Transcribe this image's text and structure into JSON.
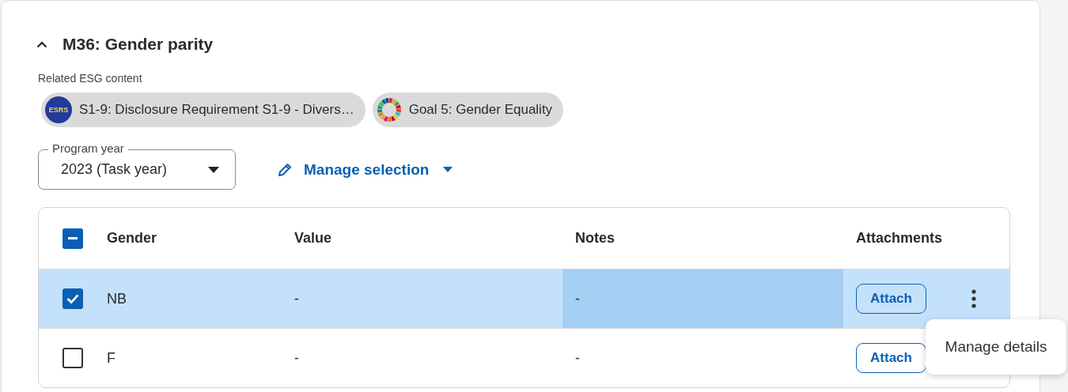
{
  "section": {
    "title": "M36: Gender parity",
    "expanded": true
  },
  "related": {
    "label": "Related ESG content",
    "chips": [
      {
        "kind": "esrs",
        "badge": "ESRS",
        "label": "S1-9: Disclosure Requirement S1-9 - Divers…"
      },
      {
        "kind": "sdg",
        "label": "Goal 5: Gender Equality"
      }
    ]
  },
  "program_year": {
    "label": "Program year",
    "value": "2023 (Task year)"
  },
  "manage_selection": {
    "label": "Manage selection"
  },
  "table": {
    "select_all": {
      "checked": true,
      "indeterminate": true
    },
    "columns": [
      "Gender",
      "Value",
      "Notes",
      "Attachments"
    ],
    "rows": [
      {
        "gender": "NB",
        "value": "-",
        "notes": "-",
        "attach": "Attach",
        "checked": true,
        "selected": true,
        "notes_hovered": true,
        "menu_open": true
      },
      {
        "gender": "F",
        "value": "-",
        "notes": "-",
        "attach": "Attach",
        "checked": false,
        "selected": false,
        "notes_hovered": false,
        "menu_open": false
      }
    ]
  },
  "row_menu": {
    "items": [
      "Manage details"
    ]
  }
}
